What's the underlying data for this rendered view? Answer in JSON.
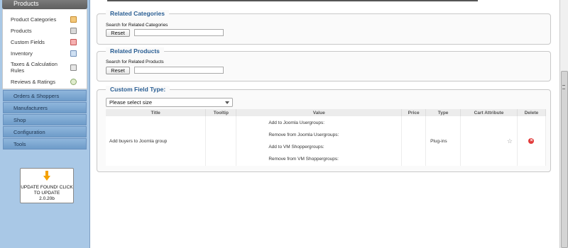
{
  "sidebar": {
    "header": "Products",
    "items": [
      {
        "label": "Product Categories",
        "icon": "categories-icon"
      },
      {
        "label": "Products",
        "icon": "products-icon"
      },
      {
        "label": "Custom Fields",
        "icon": "custom-fields-icon"
      },
      {
        "label": "Inventory",
        "icon": "inventory-icon"
      },
      {
        "label": "Taxes & Calculation Rules",
        "icon": "taxes-icon"
      },
      {
        "label": "Reviews & Ratings",
        "icon": "reviews-icon"
      }
    ],
    "sections": [
      "Orders & Shoppers",
      "Manufacturers",
      "Shop",
      "Configuration",
      "Tools"
    ],
    "update": {
      "line1": "UPDATE FOUND! CLICK",
      "line2": "TO UPDATE",
      "line3": "2.0.20b"
    }
  },
  "related_categories": {
    "legend": "Related Categories",
    "search_label": "Search for Related Categories",
    "reset_label": "Reset",
    "search_value": ""
  },
  "related_products": {
    "legend": "Related Products",
    "search_label": "Search for Related Products",
    "reset_label": "Reset",
    "search_value": ""
  },
  "custom_field_type": {
    "legend": "Custom Field Type:",
    "selected": "Please select size",
    "columns": [
      "Title",
      "Tooltip",
      "Value",
      "Price",
      "Type",
      "Cart Attribute",
      "Delete"
    ],
    "rows": [
      {
        "title": "Add buyers to Joomla group",
        "tooltip": "",
        "values": [
          "Add to Joomla Usergroups:",
          "Remove from Joomla Usergroups:",
          "Add to VM Shoppergroups:",
          "Remove from VM Shoppergroups:"
        ],
        "price": "",
        "type": "Plug-ins"
      }
    ]
  },
  "colors": {
    "legend": "#2a5e93",
    "sidebar": "#a9c8e6",
    "section": "#7aa6d2"
  }
}
